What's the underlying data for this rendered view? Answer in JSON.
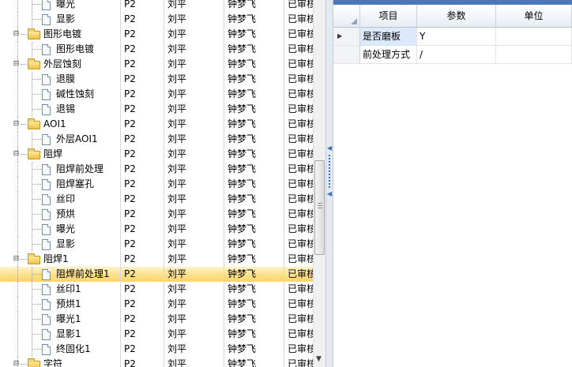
{
  "tree": {
    "rows": [
      {
        "name": "曝光",
        "kind": "doc",
        "version": "P2",
        "user1": "刘平",
        "user2": "钟梦飞",
        "status": "已审核"
      },
      {
        "name": "显影",
        "kind": "doc",
        "version": "P2",
        "user1": "刘平",
        "user2": "钟梦飞",
        "status": "已审核"
      },
      {
        "name": "图形电镀",
        "kind": "folder",
        "version": "P2",
        "user1": "刘平",
        "user2": "钟梦飞",
        "status": "已审核"
      },
      {
        "name": "图形电镀",
        "kind": "doc",
        "version": "P2",
        "user1": "刘平",
        "user2": "钟梦飞",
        "status": "已审核"
      },
      {
        "name": "外层蚀刻",
        "kind": "folder",
        "version": "P2",
        "user1": "刘平",
        "user2": "钟梦飞",
        "status": "已审核"
      },
      {
        "name": "退膜",
        "kind": "doc",
        "version": "P2",
        "user1": "刘平",
        "user2": "钟梦飞",
        "status": "已审核"
      },
      {
        "name": "碱性蚀刻",
        "kind": "doc",
        "version": "P2",
        "user1": "刘平",
        "user2": "钟梦飞",
        "status": "已审核"
      },
      {
        "name": "退锡",
        "kind": "doc",
        "version": "P2",
        "user1": "刘平",
        "user2": "钟梦飞",
        "status": "已审核"
      },
      {
        "name": "AOI1",
        "kind": "folder",
        "version": "P2",
        "user1": "刘平",
        "user2": "钟梦飞",
        "status": "已审核"
      },
      {
        "name": "外层AOI1",
        "kind": "doc",
        "version": "P2",
        "user1": "刘平",
        "user2": "钟梦飞",
        "status": "已审核"
      },
      {
        "name": "阻焊",
        "kind": "folder",
        "version": "P2",
        "user1": "刘平",
        "user2": "钟梦飞",
        "status": "已审核"
      },
      {
        "name": "阻焊前处理",
        "kind": "doc",
        "version": "P2",
        "user1": "刘平",
        "user2": "钟梦飞",
        "status": "已审核"
      },
      {
        "name": "阻焊塞孔",
        "kind": "doc",
        "version": "P2",
        "user1": "刘平",
        "user2": "钟梦飞",
        "status": "已审核"
      },
      {
        "name": "丝印",
        "kind": "doc",
        "version": "P2",
        "user1": "刘平",
        "user2": "钟梦飞",
        "status": "已审核"
      },
      {
        "name": "预烘",
        "kind": "doc",
        "version": "P2",
        "user1": "刘平",
        "user2": "钟梦飞",
        "status": "已审核"
      },
      {
        "name": "曝光",
        "kind": "doc",
        "version": "P2",
        "user1": "刘平",
        "user2": "钟梦飞",
        "status": "已审核"
      },
      {
        "name": "显影",
        "kind": "doc",
        "version": "P2",
        "user1": "刘平",
        "user2": "钟梦飞",
        "status": "已审核"
      },
      {
        "name": "阻焊1",
        "kind": "folder",
        "version": "P2",
        "user1": "刘平",
        "user2": "钟梦飞",
        "status": "已审核"
      },
      {
        "name": "阻焊前处理1",
        "kind": "doc",
        "version": "P2",
        "user1": "刘平",
        "user2": "钟梦飞",
        "status": "已审核",
        "selected": true
      },
      {
        "name": "丝印1",
        "kind": "doc",
        "version": "P2",
        "user1": "刘平",
        "user2": "钟梦飞",
        "status": "已审核"
      },
      {
        "name": "预烘1",
        "kind": "doc",
        "version": "P2",
        "user1": "刘平",
        "user2": "钟梦飞",
        "status": "已审核"
      },
      {
        "name": "曝光1",
        "kind": "doc",
        "version": "P2",
        "user1": "刘平",
        "user2": "钟梦飞",
        "status": "已审核"
      },
      {
        "name": "显影1",
        "kind": "doc",
        "version": "P2",
        "user1": "刘平",
        "user2": "钟梦飞",
        "status": "已审核"
      },
      {
        "name": "终固化1",
        "kind": "doc",
        "version": "P2",
        "user1": "刘平",
        "user2": "钟梦飞",
        "status": "已审核"
      },
      {
        "name": "字符",
        "kind": "folder",
        "version": "P2",
        "user1": "刘平",
        "user2": "钟梦飞",
        "status": "已审核"
      }
    ]
  },
  "grid": {
    "headers": {
      "item": "项目",
      "param": "参数",
      "unit": "单位"
    },
    "rows": [
      {
        "item": "是否磨板",
        "param": "Y",
        "unit": "",
        "current": true
      },
      {
        "item": "前处理方式",
        "param": "/",
        "unit": "",
        "current": false
      }
    ]
  },
  "icons": {
    "expander": "collapse-minus-icon",
    "folder": "folder-icon",
    "doc": "document-icon",
    "scroll_down": "arrow-down-icon",
    "splitter": "splitter-arrow-icon",
    "row_indicator": "current-row-arrow-icon"
  },
  "colors": {
    "selection": "#fde08a",
    "grid_header_bar": "#4a78b8",
    "focused_cell": "#dce9fb"
  }
}
